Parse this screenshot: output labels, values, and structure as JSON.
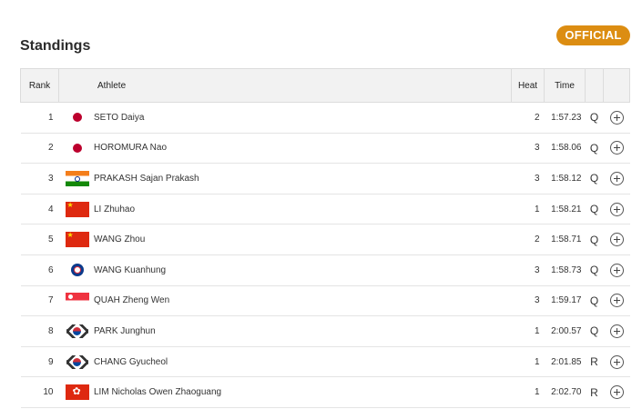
{
  "header": {
    "title": "Standings",
    "badge": "OFFICIAL"
  },
  "table": {
    "columns": {
      "rank": "Rank",
      "athlete": "Athlete",
      "heat": "Heat",
      "time": "Time"
    },
    "rows": [
      {
        "rank": "1",
        "flag": "japan-flag-icon",
        "name": "SETO Daiya",
        "heat": "2",
        "time": "1:57.23",
        "qual": "Q"
      },
      {
        "rank": "2",
        "flag": "japan-flag-icon",
        "name": "HOROMURA Nao",
        "heat": "3",
        "time": "1:58.06",
        "qual": "Q"
      },
      {
        "rank": "3",
        "flag": "india-flag-icon",
        "name": "PRAKASH Sajan Prakash",
        "heat": "3",
        "time": "1:58.12",
        "qual": "Q"
      },
      {
        "rank": "4",
        "flag": "china-flag-icon",
        "name": "LI Zhuhao",
        "heat": "1",
        "time": "1:58.21",
        "qual": "Q"
      },
      {
        "rank": "5",
        "flag": "china-flag-icon",
        "name": "WANG Zhou",
        "heat": "2",
        "time": "1:58.71",
        "qual": "Q"
      },
      {
        "rank": "6",
        "flag": "chinese-taipei-flag-icon",
        "name": "WANG Kuanhung",
        "heat": "3",
        "time": "1:58.73",
        "qual": "Q"
      },
      {
        "rank": "7",
        "flag": "singapore-flag-icon",
        "name": "QUAH Zheng Wen",
        "heat": "3",
        "time": "1:59.17",
        "qual": "Q"
      },
      {
        "rank": "8",
        "flag": "korea-flag-icon",
        "name": "PARK Junghun",
        "heat": "1",
        "time": "2:00.57",
        "qual": "Q"
      },
      {
        "rank": "9",
        "flag": "korea-flag-icon",
        "name": "CHANG Gyucheol",
        "heat": "1",
        "time": "2:01.85",
        "qual": "R"
      },
      {
        "rank": "10",
        "flag": "hong-kong-flag-icon",
        "name": "LIM Nicholas Owen Zhaoguang",
        "heat": "1",
        "time": "2:02.70",
        "qual": "R"
      }
    ]
  },
  "colors": {
    "badge": "#dc8d12",
    "header_bg": "#f2f2f2"
  }
}
